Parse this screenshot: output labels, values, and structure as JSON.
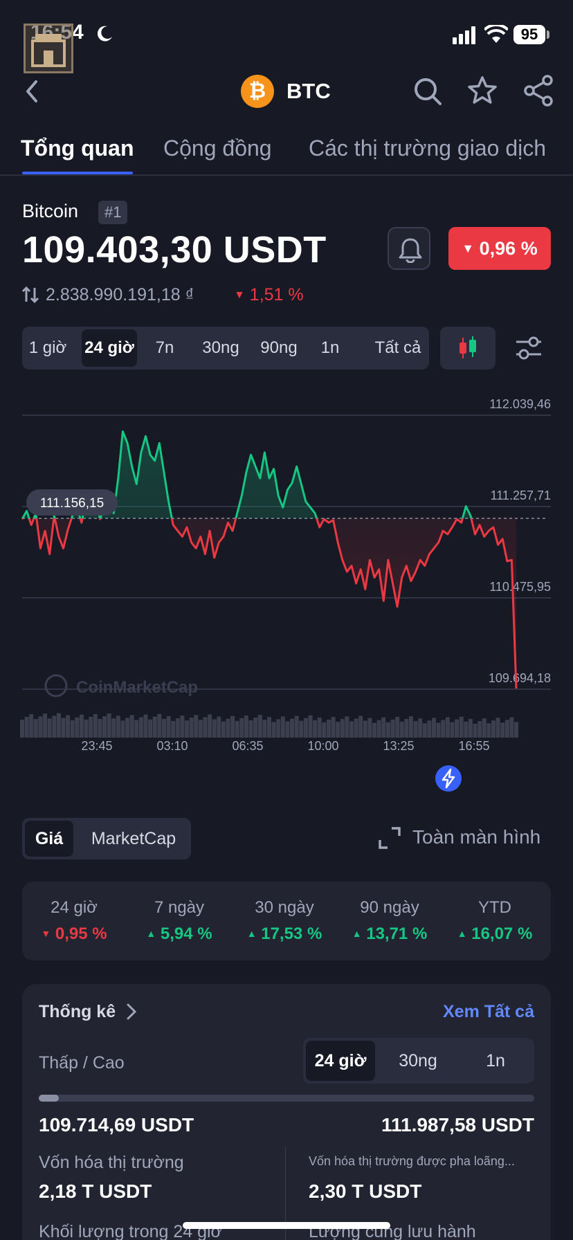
{
  "status_bar": {
    "time": "16:54",
    "battery": "95"
  },
  "nav": {
    "symbol": "BTC",
    "logo_glyph": "₿"
  },
  "tabs": [
    {
      "label": "Tổng quan",
      "active": true
    },
    {
      "label": "Cộng đồng",
      "active": false
    },
    {
      "label": "Các thị trường giao dịch",
      "active": false
    }
  ],
  "coin": {
    "name": "Bitcoin",
    "rank": "#1",
    "price": "109.403,30  USDT",
    "change_24h": "0,96 %",
    "fiat_price": "2.838.990.191,18 ₫",
    "fiat_change": "1,51 %"
  },
  "time_ranges": [
    "1 giờ",
    "24 giờ",
    "7n",
    "30ng",
    "90ng",
    "1n",
    "Tất cả"
  ],
  "time_range_selected": "24 giờ",
  "chart_data": {
    "type": "line",
    "y_tick_labels": [
      "112.039,46",
      "111.257,71",
      "110.475,95",
      "109.694,18"
    ],
    "y_ticks": [
      112039.46,
      111257.71,
      110475.95,
      109694.18
    ],
    "ylim": [
      109694.18,
      112039.46
    ],
    "x_tick_labels": [
      "23:45",
      "03:10",
      "06:35",
      "10:00",
      "13:25",
      "16:55"
    ],
    "reference_value": 111156.15,
    "reference_label": "111.156,15",
    "watermark": "CoinMarketCap",
    "colors": {
      "above": "#16c784",
      "below": "#ea3943",
      "grid": "#2f3344",
      "volume": "#3c3f4e"
    },
    "values": [
      111150,
      111220,
      111100,
      111200,
      110900,
      111050,
      110850,
      111180,
      111000,
      110900,
      111060,
      111180,
      111250,
      111120,
      111320,
      111200,
      111380,
      111150,
      111250,
      111300,
      111200,
      111500,
      111900,
      111800,
      111600,
      111450,
      111720,
      111860,
      111700,
      111650,
      111800,
      111550,
      111300,
      111100,
      111050,
      111000,
      111080,
      110950,
      110900,
      111000,
      110850,
      111050,
      110820,
      110950,
      111000,
      111120,
      111050,
      111200,
      111350,
      111550,
      111700,
      111600,
      111500,
      111720,
      111500,
      111580,
      111350,
      111250,
      111400,
      111460,
      111600,
      111450,
      111300,
      111250,
      111200,
      111080,
      111150,
      111120,
      111140,
      110950,
      110800,
      110700,
      110750,
      110600,
      110720,
      110550,
      110800,
      110650,
      110720,
      110450,
      110800,
      110600,
      110400,
      110650,
      110750,
      110620,
      110700,
      110800,
      110750,
      110850,
      110900,
      110950,
      111050,
      111020,
      111080,
      111150,
      111120,
      111260,
      111180,
      111020,
      111100,
      111000,
      111050,
      111080,
      110930,
      110980,
      110790,
      110800,
      109700
    ]
  },
  "chart_toggle": {
    "options": [
      "Giá",
      "MarketCap"
    ],
    "selected": "Giá"
  },
  "fullscreen_label": "Toàn màn hình",
  "performance": [
    {
      "label": "24 giờ",
      "value": "0,95 %",
      "direction": "down"
    },
    {
      "label": "7 ngày",
      "value": "5,94 %",
      "direction": "up"
    },
    {
      "label": "30 ngày",
      "value": "17,53 %",
      "direction": "up"
    },
    {
      "label": "90 ngày",
      "value": "13,71 %",
      "direction": "up"
    },
    {
      "label": "YTD",
      "value": "16,07 %",
      "direction": "up"
    }
  ],
  "stats": {
    "title": "Thống kê",
    "see_all": "Xem Tất cả",
    "low_high_label": "Thấp / Cao",
    "periods": [
      "24 giờ",
      "30ng",
      "1n"
    ],
    "period_selected": "24 giờ",
    "range_position": 0.04,
    "low": "109.714,69  USDT",
    "high": "111.987,58  USDT",
    "market_cap_label": "Vốn hóa thị trường",
    "market_cap": "2,18 T USDT",
    "fdv_label": "Vốn hóa thị trường được pha loãng...",
    "fdv": "2,30 T USDT",
    "volume_label": "Khối lượng trong 24 giờ",
    "supply_label": "Lượng cung lưu hành"
  }
}
